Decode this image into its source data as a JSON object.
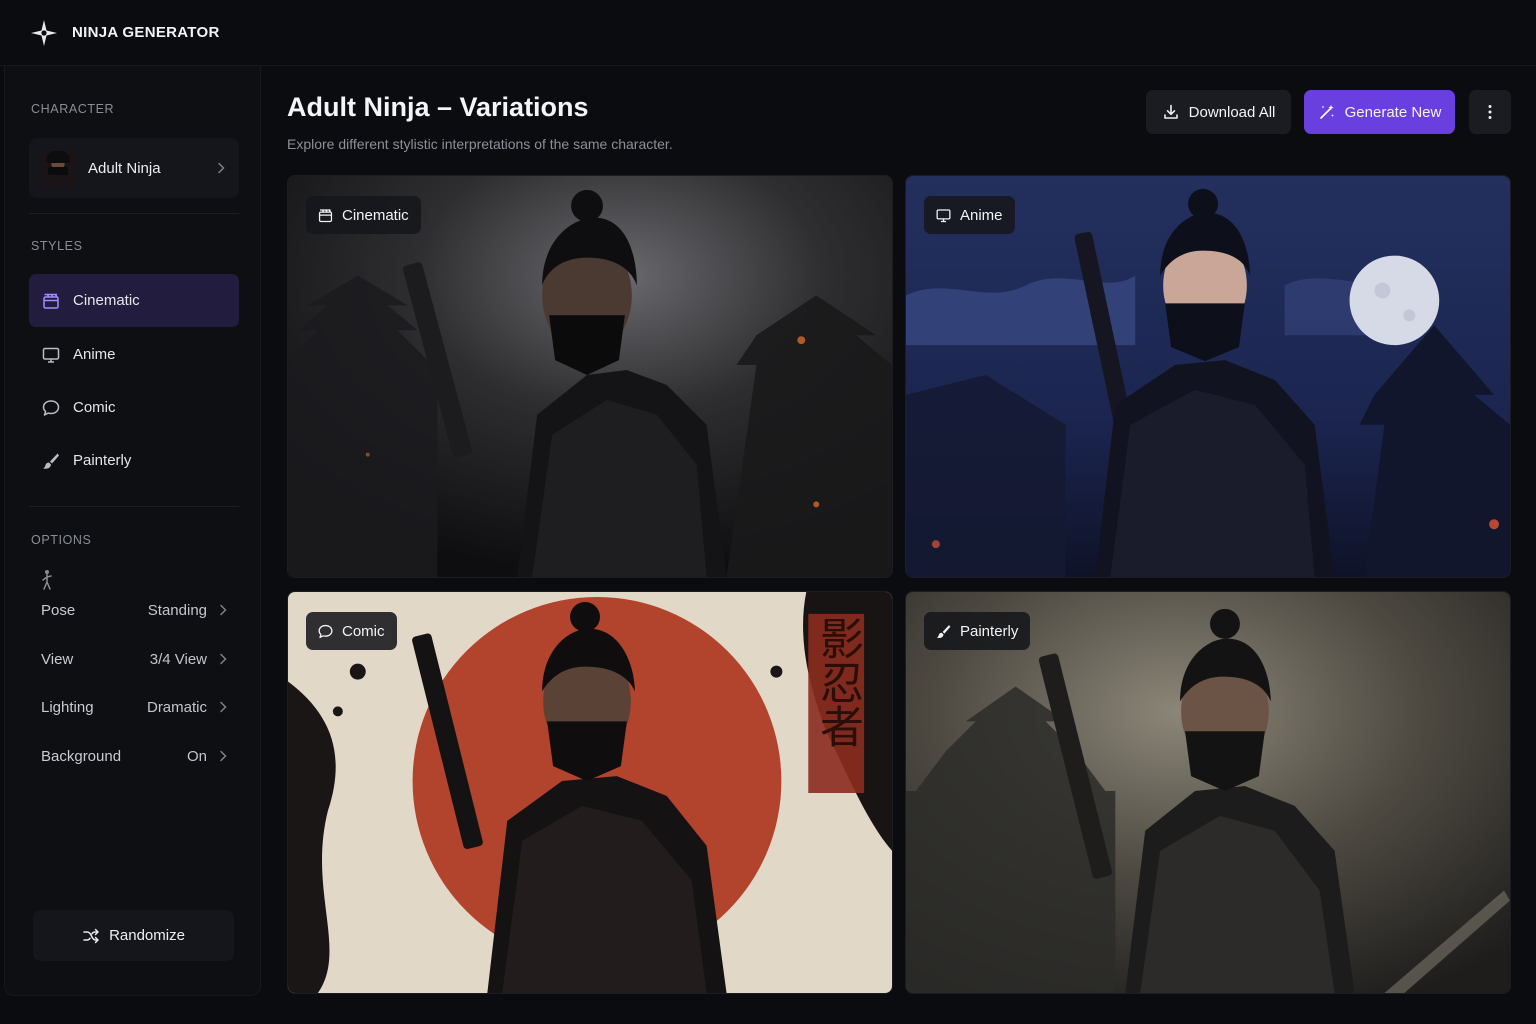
{
  "app": {
    "title": "NINJA GENERATOR"
  },
  "sidebar": {
    "character_label": "CHARACTER",
    "character": {
      "name": "Adult Ninja"
    },
    "styles_label": "STYLES",
    "styles": [
      {
        "label": "Cinematic",
        "icon": "clapperboard-icon",
        "active": true
      },
      {
        "label": "Anime",
        "icon": "monitor-icon",
        "active": false
      },
      {
        "label": "Comic",
        "icon": "speech-bubble-icon",
        "active": false
      },
      {
        "label": "Painterly",
        "icon": "brush-icon",
        "active": false
      }
    ],
    "options_label": "OPTIONS",
    "options": [
      {
        "name": "Pose",
        "value": "Standing"
      },
      {
        "name": "View",
        "value": "3/4 View"
      },
      {
        "name": "Lighting",
        "value": "Dramatic"
      },
      {
        "name": "Background",
        "value": "On"
      }
    ],
    "randomize_label": "Randomize"
  },
  "main": {
    "title": "Adult Ninja – Variations",
    "subtitle": "Explore different stylistic interpretations of the same character.",
    "download_label": "Download All",
    "generate_label": "Generate New",
    "cards": [
      {
        "label": "Cinematic",
        "icon": "clapperboard-icon"
      },
      {
        "label": "Anime",
        "icon": "monitor-icon"
      },
      {
        "label": "Comic",
        "icon": "speech-bubble-icon"
      },
      {
        "label": "Painterly",
        "icon": "brush-icon"
      }
    ],
    "comic_kanji": "影忍者"
  },
  "colors": {
    "accent": "#6a3fe0",
    "active_style_bg": "#221c3e",
    "background": "#0b0c10"
  }
}
